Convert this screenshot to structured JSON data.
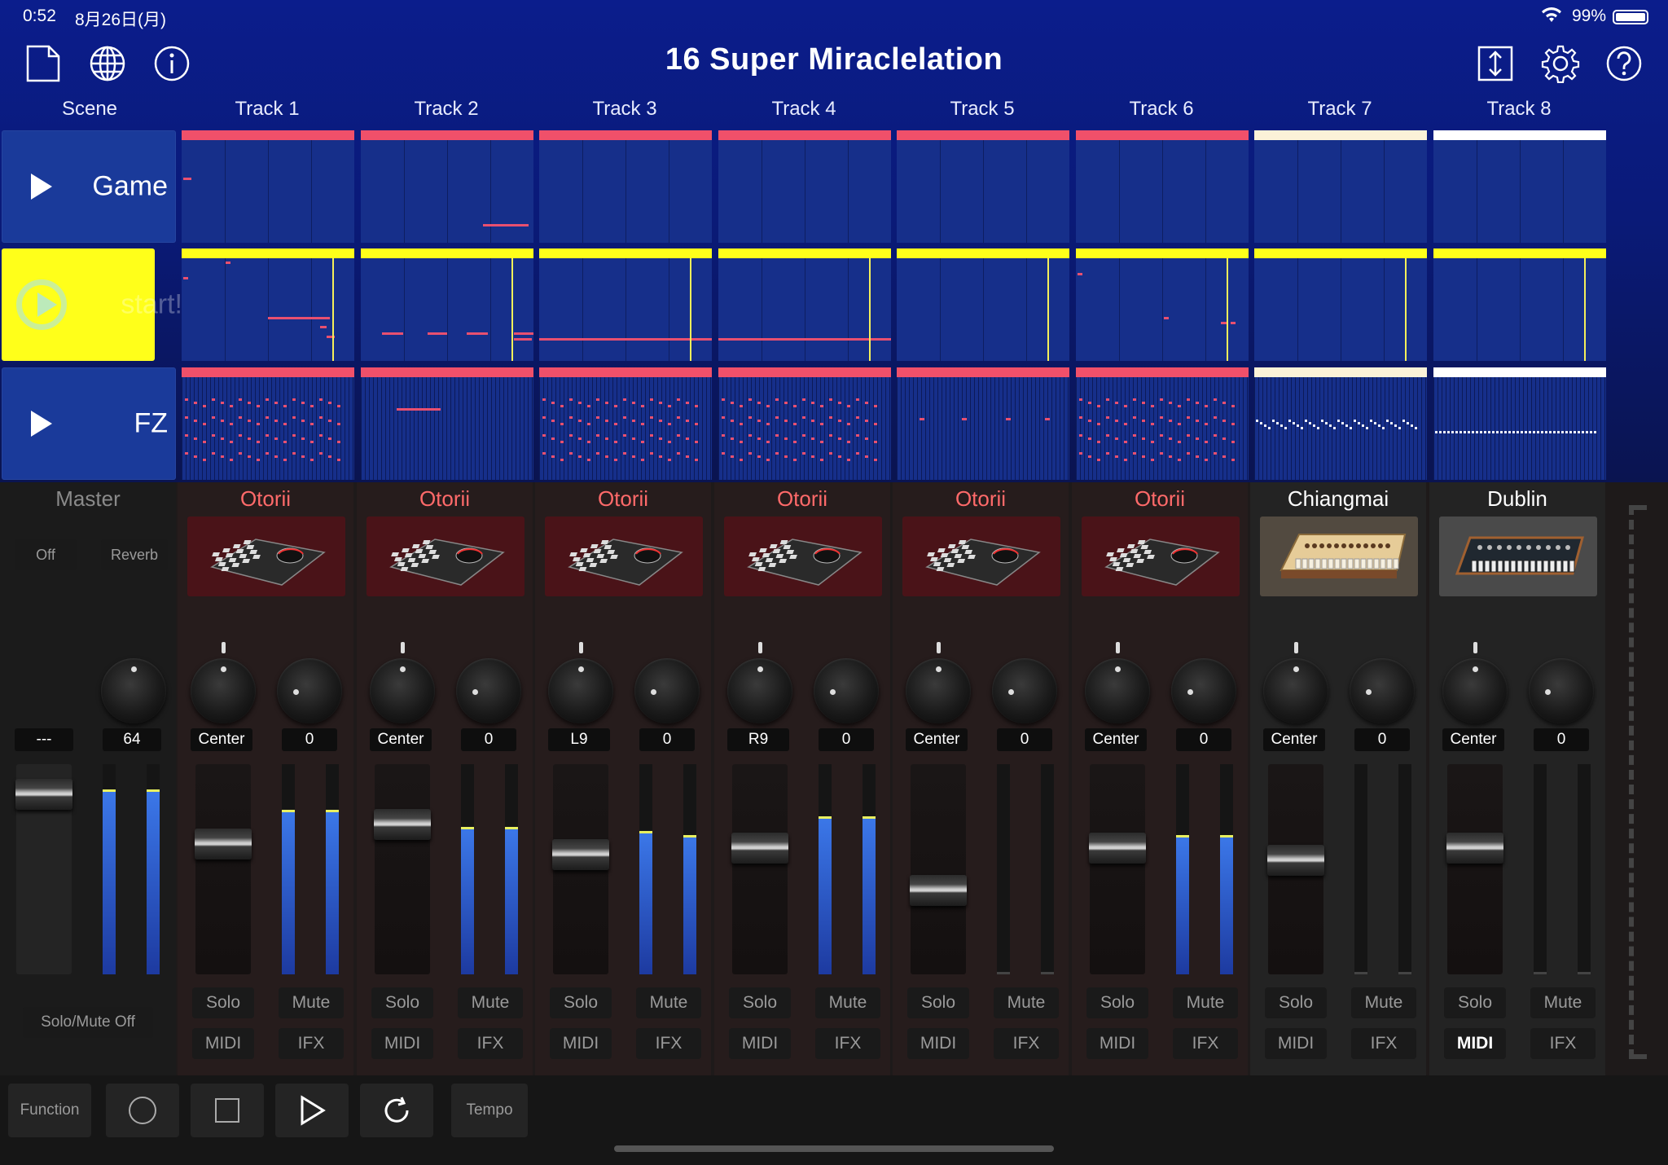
{
  "status_bar": {
    "time": "0:52",
    "date": "8月26日(月)",
    "battery": "99%"
  },
  "header": {
    "title": "16 Super Miraclelation",
    "left_icons": [
      "new-document-icon",
      "globe-icon",
      "info-icon"
    ],
    "right_icons": [
      "arrange-icon",
      "gear-icon",
      "help-icon"
    ]
  },
  "columns": {
    "scene": "Scene",
    "tracks": [
      "Track 1",
      "Track 2",
      "Track 3",
      "Track 4",
      "Track 5",
      "Track 6",
      "Track 7",
      "Track 8"
    ]
  },
  "scenes": [
    {
      "name": "Game",
      "state": "stopped"
    },
    {
      "name": "start!",
      "state": "playing"
    },
    {
      "name": "FZ",
      "state": "stopped"
    }
  ],
  "colors": {
    "accent_yellow": "#ffff1a",
    "clip_red": "#f0506a",
    "clip_cream": "#fbf2d8",
    "clip_white": "#ffffff",
    "clip_bg": "#162f8a",
    "header_bg": "#0b1d8c"
  },
  "master": {
    "label": "Master",
    "off_label": "Off",
    "reverb_label": "Reverb",
    "pan_value": "---",
    "reverb_value": "64",
    "solo_mute_off_label": "Solo/Mute Off",
    "fader_level": 0.92,
    "meter_levels": [
      0.87,
      0.87
    ]
  },
  "strips": [
    {
      "name": "Otorii",
      "pan": "Center",
      "send": "0",
      "fader_level": 0.64,
      "meters": [
        0.0,
        0.0
      ],
      "solo": "Solo",
      "mute": "Mute",
      "midi": "MIDI",
      "ifx": "IFX",
      "midi_on": false,
      "instrument": "pad-controller",
      "name_color": "#ff6a6a"
    },
    {
      "name": "Otorii",
      "pan": "Center",
      "send": "0",
      "fader_level": 0.75,
      "meters": [
        0.0,
        0.0
      ],
      "solo": "Solo",
      "mute": "Mute",
      "midi": "MIDI",
      "ifx": "IFX",
      "midi_on": false,
      "instrument": "pad-controller",
      "name_color": "#ff6a6a"
    },
    {
      "name": "Otorii",
      "pan": "L9",
      "send": "0",
      "fader_level": 0.58,
      "meters": [
        0.0,
        0.0
      ],
      "solo": "Solo",
      "mute": "Mute",
      "midi": "MIDI",
      "ifx": "IFX",
      "midi_on": false,
      "instrument": "pad-controller",
      "name_color": "#ff6a6a"
    },
    {
      "name": "Otorii",
      "pan": "R9",
      "send": "0",
      "fader_level": 0.62,
      "meters": [
        0.0,
        0.0
      ],
      "solo": "Solo",
      "mute": "Mute",
      "midi": "MIDI",
      "ifx": "IFX",
      "midi_on": false,
      "instrument": "pad-controller",
      "name_color": "#ff6a6a"
    },
    {
      "name": "Otorii",
      "pan": "Center",
      "send": "0",
      "fader_level": 0.38,
      "meters": [
        0.0,
        0.0
      ],
      "solo": "Solo",
      "mute": "Mute",
      "midi": "MIDI",
      "ifx": "IFX",
      "midi_on": false,
      "instrument": "pad-controller",
      "name_color": "#ff6a6a"
    },
    {
      "name": "Otorii",
      "pan": "Center",
      "send": "0",
      "fader_level": 0.62,
      "meters": [
        0.0,
        0.0
      ],
      "solo": "Solo",
      "mute": "Mute",
      "midi": "MIDI",
      "ifx": "IFX",
      "midi_on": false,
      "instrument": "pad-controller",
      "name_color": "#ff6a6a"
    },
    {
      "name": "Chiangmai",
      "pan": "Center",
      "send": "0",
      "fader_level": 0.55,
      "meters": [
        0.0,
        0.0
      ],
      "solo": "Solo",
      "mute": "Mute",
      "midi": "MIDI",
      "ifx": "IFX",
      "midi_on": false,
      "instrument": "beige-synth",
      "name_color": "#ffffff"
    },
    {
      "name": "Dublin",
      "pan": "Center",
      "send": "0",
      "fader_level": 0.62,
      "meters": [
        0.0,
        0.0
      ],
      "solo": "Solo",
      "mute": "Mute",
      "midi": "MIDI",
      "ifx": "IFX",
      "midi_on": true,
      "instrument": "dark-synth",
      "name_color": "#ffffff"
    }
  ],
  "meter_levels": [
    [
      0.77,
      0.77
    ],
    [
      0.69,
      0.69
    ],
    [
      0.67,
      0.65
    ],
    [
      0.74,
      0.74
    ],
    [
      0,
      0
    ],
    [
      0.65,
      0.65
    ],
    [
      0,
      0
    ],
    [
      0,
      0
    ]
  ],
  "transport": {
    "function_label": "Function",
    "tempo_label": "Tempo",
    "buttons": [
      "record-icon",
      "stop-icon",
      "play-icon",
      "loop-icon"
    ]
  }
}
